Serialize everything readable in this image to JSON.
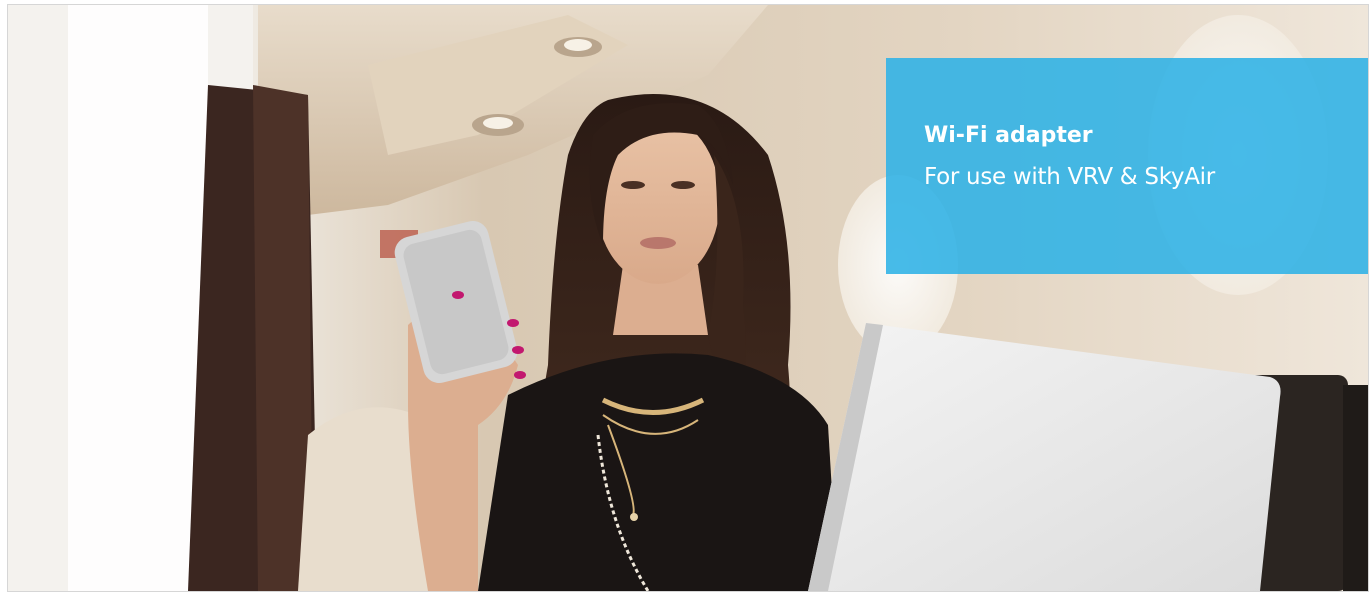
{
  "banner": {
    "image_description": "woman-using-smartphone-in-aircraft-cabin",
    "title": "Wi-Fi adapter",
    "subtitle": "For use with VRV & SkyAir",
    "colors": {
      "box": "#2eb2e6",
      "text": "#ffffff"
    }
  }
}
